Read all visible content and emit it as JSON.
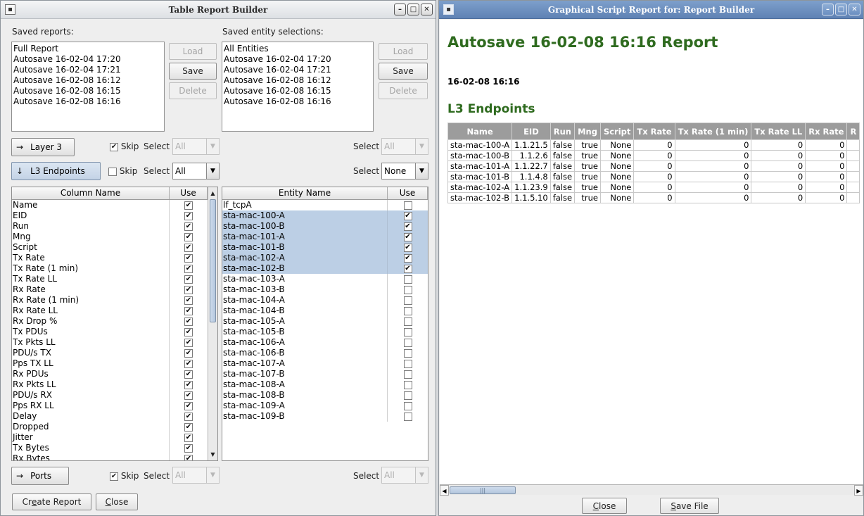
{
  "left_window": {
    "title": "Table Report Builder",
    "saved_reports_label": "Saved reports:",
    "saved_reports": [
      "Full Report",
      "Autosave 16-02-04 17:20",
      "Autosave 16-02-04 17:21",
      "Autosave 16-02-08 16:12",
      "Autosave 16-02-08 16:15",
      "Autosave 16-02-08 16:16"
    ],
    "saved_entities_label": "Saved entity selections:",
    "saved_entities": [
      "All Entities",
      "Autosave 16-02-04 17:20",
      "Autosave 16-02-04 17:21",
      "Autosave 16-02-08 16:12",
      "Autosave 16-02-08 16:15",
      "Autosave 16-02-08 16:16"
    ],
    "load_label": "Load",
    "save_label": "Save",
    "delete_label": "Delete",
    "arrow_right": "→",
    "arrow_down": "↓",
    "layer3_label": "Layer 3",
    "l3_endpoints_label": "L3 Endpoints",
    "ports_label": "Ports",
    "skip_label": "Skip",
    "select_label": "Select",
    "select_values": {
      "layer3": "All",
      "l3_endpoints": "All",
      "ports": "All",
      "entity_layer3": "All",
      "entity_l3": "None",
      "entity_ports": "All"
    },
    "column_table": {
      "headers": [
        "Column Name",
        "Use"
      ],
      "rows": [
        "Name",
        "EID",
        "Run",
        "Mng",
        "Script",
        "Tx Rate",
        "Tx Rate (1 min)",
        "Tx Rate LL",
        "Rx Rate",
        "Rx Rate (1 min)",
        "Rx Rate LL",
        "Rx Drop %",
        "Tx PDUs",
        "Tx Pkts LL",
        "PDU/s TX",
        "Pps TX LL",
        "Rx PDUs",
        "Rx Pkts LL",
        "PDU/s RX",
        "Pps RX LL",
        "Delay",
        "Dropped",
        "Jitter",
        "Tx Bytes",
        "Rx Bytes"
      ]
    },
    "entity_table": {
      "headers": [
        "Entity Name",
        "Use"
      ],
      "rows": [
        {
          "name": "lf_tcpA",
          "use": false
        },
        {
          "name": "sta-mac-100-A",
          "use": true
        },
        {
          "name": "sta-mac-100-B",
          "use": true
        },
        {
          "name": "sta-mac-101-A",
          "use": true
        },
        {
          "name": "sta-mac-101-B",
          "use": true
        },
        {
          "name": "sta-mac-102-A",
          "use": true
        },
        {
          "name": "sta-mac-102-B",
          "use": true
        },
        {
          "name": "sta-mac-103-A",
          "use": false
        },
        {
          "name": "sta-mac-103-B",
          "use": false
        },
        {
          "name": "sta-mac-104-A",
          "use": false
        },
        {
          "name": "sta-mac-104-B",
          "use": false
        },
        {
          "name": "sta-mac-105-A",
          "use": false
        },
        {
          "name": "sta-mac-105-B",
          "use": false
        },
        {
          "name": "sta-mac-106-A",
          "use": false
        },
        {
          "name": "sta-mac-106-B",
          "use": false
        },
        {
          "name": "sta-mac-107-A",
          "use": false
        },
        {
          "name": "sta-mac-107-B",
          "use": false
        },
        {
          "name": "sta-mac-108-A",
          "use": false
        },
        {
          "name": "sta-mac-108-B",
          "use": false
        },
        {
          "name": "sta-mac-109-A",
          "use": false
        },
        {
          "name": "sta-mac-109-B",
          "use": false
        }
      ]
    },
    "create_report_prefix": "Cr",
    "create_report_mnemonic": "e",
    "create_report_suffix": "ate Report",
    "close_mnemonic": "C",
    "close_suffix": "lose"
  },
  "right_window": {
    "title": "Graphical Script Report for:  Report Builder",
    "report_title": "Autosave 16-02-08 16:16 Report",
    "report_date": "16-02-08 16:16",
    "section_title": "L3 Endpoints",
    "table_headers": [
      "Name",
      "EID",
      "Run",
      "Mng",
      "Script",
      "Tx Rate",
      "Tx Rate (1 min)",
      "Tx Rate LL",
      "Rx Rate",
      "R"
    ],
    "table_rows": [
      [
        "sta-mac-100-A",
        "1.1.21.5",
        "false",
        "true",
        "None",
        "0",
        "0",
        "0",
        "0",
        ""
      ],
      [
        "sta-mac-100-B",
        "1.1.2.6",
        "false",
        "true",
        "None",
        "0",
        "0",
        "0",
        "0",
        ""
      ],
      [
        "sta-mac-101-A",
        "1.1.22.7",
        "false",
        "true",
        "None",
        "0",
        "0",
        "0",
        "0",
        ""
      ],
      [
        "sta-mac-101-B",
        "1.1.4.8",
        "false",
        "true",
        "None",
        "0",
        "0",
        "0",
        "0",
        ""
      ],
      [
        "sta-mac-102-A",
        "1.1.23.9",
        "false",
        "true",
        "None",
        "0",
        "0",
        "0",
        "0",
        ""
      ],
      [
        "sta-mac-102-B",
        "1.1.5.10",
        "false",
        "true",
        "None",
        "0",
        "0",
        "0",
        "0",
        ""
      ]
    ],
    "close_mnemonic": "C",
    "close_suffix": "lose",
    "save_file_mnemonic": "S",
    "save_file_suffix": "ave File"
  },
  "colors": {
    "report_green": "#2f6b1f",
    "selection": "#bccfe5",
    "header_gray": "#9c9c9c"
  },
  "icons": {
    "window_menu": "app-icon",
    "minimize": "minimize-icon",
    "maximize": "maximize-icon",
    "close": "close-icon",
    "check": "✔"
  }
}
